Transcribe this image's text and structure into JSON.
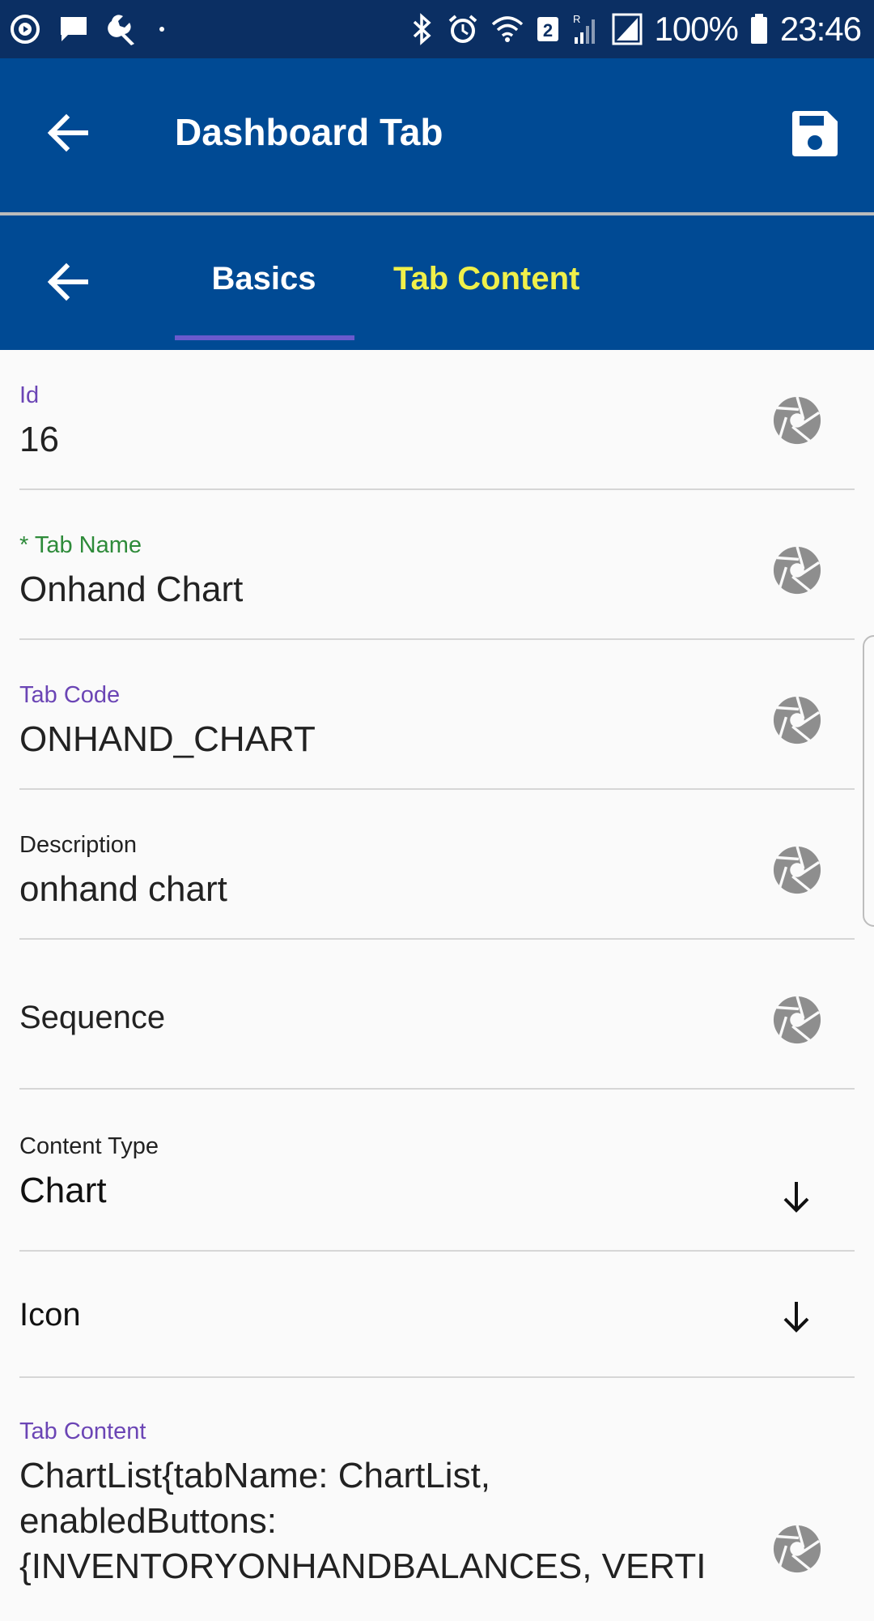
{
  "status_bar": {
    "battery": "100%",
    "time": "23:46",
    "sim_badge": "2",
    "signal_label": "R",
    "icons": [
      "play-circle-icon",
      "chat-bubble-icon",
      "wrench-icon",
      "dot-icon",
      "bluetooth-icon",
      "alarm-icon",
      "wifi-icon",
      "signal-icon",
      "battery-icon"
    ]
  },
  "app_bar": {
    "title": "Dashboard Tab",
    "back_icon": "arrow-back-icon",
    "save_icon": "save-icon"
  },
  "tabs": {
    "back_icon": "arrow-back-icon",
    "items": [
      {
        "label": "Basics",
        "active": true
      },
      {
        "label": "Tab Content",
        "active": false
      }
    ],
    "colors": {
      "active": "#ffffff",
      "inactive": "#f0f04a",
      "indicator": "#6a5acd"
    }
  },
  "form": {
    "fields": [
      {
        "label": "Id",
        "value": "16",
        "icon": "aperture-icon"
      },
      {
        "label": "* Tab Name",
        "value": "Onhand Chart",
        "icon": "aperture-icon"
      },
      {
        "label": "Tab Code",
        "value": "ONHAND_CHART",
        "icon": "aperture-icon"
      },
      {
        "label": "Description",
        "value": "onhand chart",
        "icon": "aperture-icon"
      },
      {
        "placeholder": "Sequence",
        "icon": "aperture-icon"
      },
      {
        "label": "Content Type",
        "value": "Chart",
        "icon": "arrow-down-icon"
      },
      {
        "placeholder": "Icon",
        "icon": "arrow-down-icon"
      },
      {
        "label": "Tab Content",
        "value_lines": [
          "ChartList{tabName: ChartList,",
          "enabledButtons:",
          "{INVENTORYONHANDBALANCES, VERTI"
        ],
        "icon": "aperture-icon"
      }
    ]
  },
  "colors": {
    "status_bar": "#0b2f63",
    "app_bar": "#004a94",
    "label_purple": "#6b45b5",
    "label_green": "#2e8b3a",
    "icon_gray": "#8e8e8e"
  }
}
